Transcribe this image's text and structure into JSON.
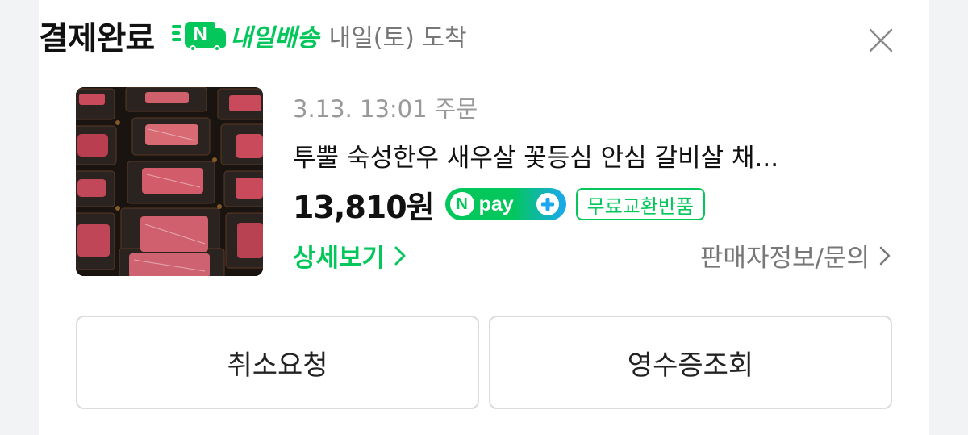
{
  "header": {
    "status_title": "결제완료",
    "delivery_badge_letter": "N",
    "delivery_label": "내일배송",
    "arrival_text": "내일(토) 도착"
  },
  "order": {
    "date_text": "3.13. 13:01 주문",
    "product_name": "투뿔 숙성한우 새우살 꽃등심 안심 갈비살 채...",
    "price": "13,810원",
    "npay": {
      "letter": "N",
      "word": "pay"
    },
    "return_badge": "무료교환반품",
    "detail_link": "상세보기",
    "seller_link": "판매자정보/문의"
  },
  "actions": {
    "cancel_label": "취소요청",
    "receipt_label": "영수증조회"
  },
  "colors": {
    "accent_green": "#03c75a",
    "npay_blue": "#1ba8f0",
    "text_primary": "#111111",
    "text_secondary": "#777777"
  },
  "icons": {
    "close": "close-icon",
    "delivery": "truck-icon",
    "chevron": "chevron-right-icon",
    "npay_plus": "plus-icon"
  }
}
